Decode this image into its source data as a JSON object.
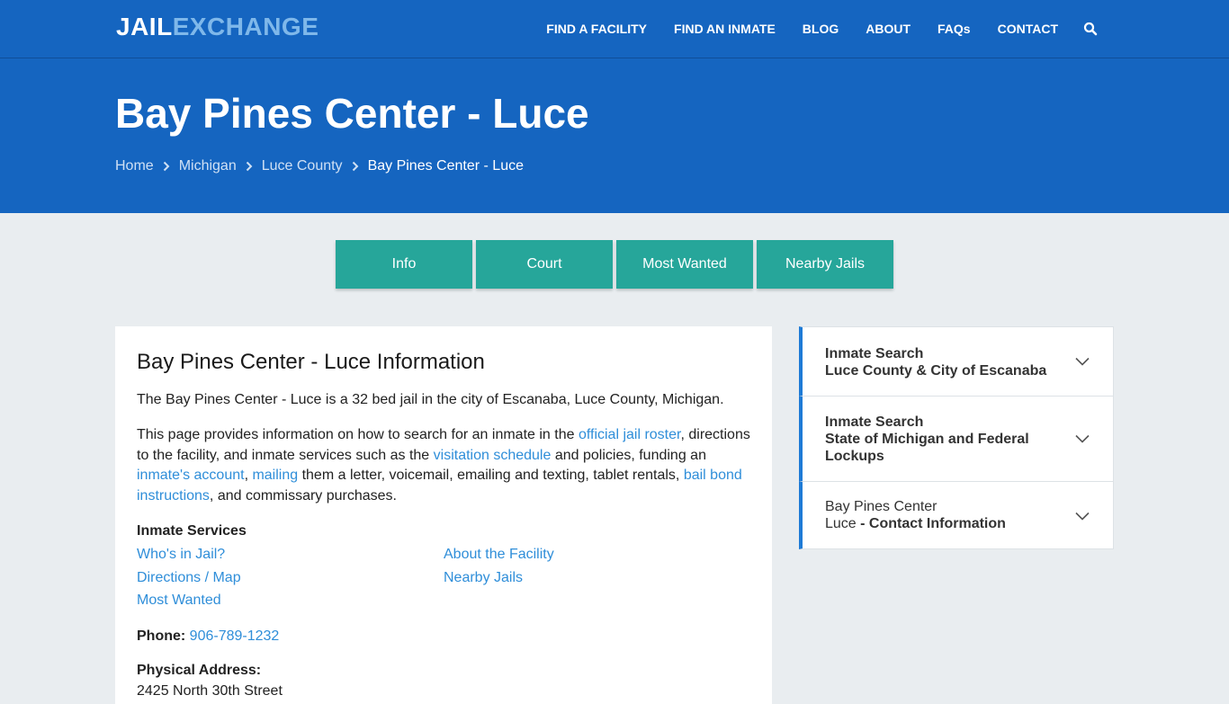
{
  "header": {
    "logo_part1": "JAIL",
    "logo_part2": "EXCHANGE",
    "nav": [
      "FIND A FACILITY",
      "FIND AN INMATE",
      "BLOG",
      "ABOUT",
      "FAQs",
      "CONTACT"
    ],
    "icon": "search-icon"
  },
  "hero": {
    "title": "Bay Pines Center - Luce",
    "breadcrumb": [
      "Home",
      "Michigan",
      "Luce County",
      "Bay Pines Center - Luce"
    ]
  },
  "tabs": [
    "Info",
    "Court",
    "Most Wanted",
    "Nearby Jails"
  ],
  "main": {
    "heading": "Bay Pines Center - Luce Information",
    "intro": "The Bay Pines Center - Luce is a 32 bed jail in the city of Escanaba, Luce County, Michigan.",
    "para": {
      "t1": "This page provides information on how to search for an inmate in the ",
      "l1": "official jail roster",
      "t2": ", directions to the facility, and inmate services such as the ",
      "l2": "visitation schedule",
      "t3": " and policies, funding an ",
      "l3": "inmate's account",
      "t4": ", ",
      "l4": "mailing",
      "t5": " them a letter, voicemail, emailing and texting, tablet rentals, ",
      "l5": "bail bond instructions",
      "t6": ", and commissary purchases."
    },
    "services_title": "Inmate Services",
    "services": [
      "Who's in Jail?",
      "About the Facility",
      "Directions / Map",
      "Nearby Jails",
      "Most Wanted"
    ],
    "phone_label": "Phone:",
    "phone": "906-789-1232",
    "address_label": "Physical Address:",
    "address_line1": "2425 North 30th Street"
  },
  "sidebar": [
    {
      "line1": "Inmate Search",
      "line2": "Luce County & City of Escanaba"
    },
    {
      "line1": "Inmate Search",
      "line2": "State of Michigan and Federal",
      "line3": "Lockups"
    },
    {
      "line1": "Bay Pines Center",
      "line2a": "Luce",
      "line2b": " - Contact Information"
    }
  ],
  "colors": {
    "header_blue": "#1565c0",
    "tab_teal": "#26a69a",
    "link": "#2f8ed9"
  }
}
